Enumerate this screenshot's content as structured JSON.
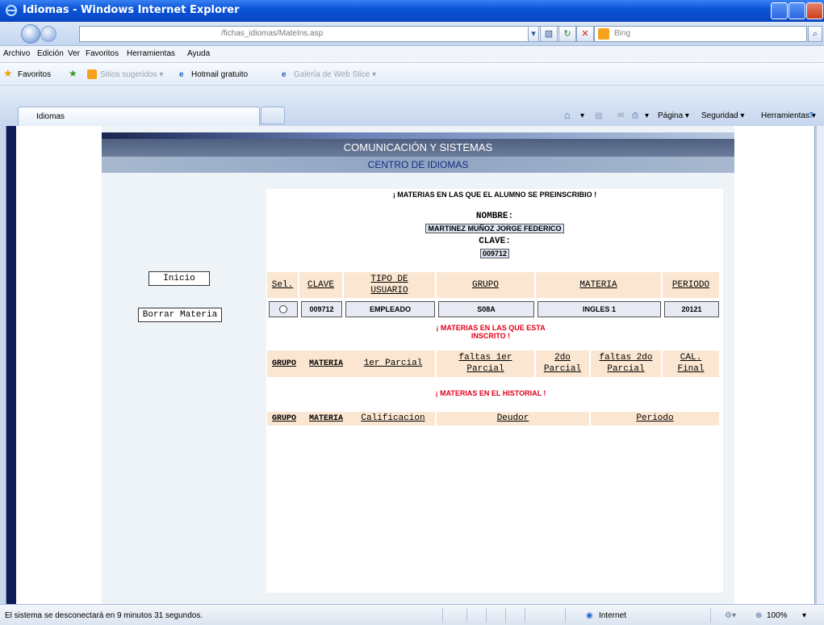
{
  "window": {
    "title": "Idiomas - Windows Internet Explorer"
  },
  "address": {
    "url": "/fichas_idiomas/MateIns.asp",
    "search_placeholder": "Bing"
  },
  "menu": {
    "items": [
      "Archivo",
      "Edición",
      "Ver",
      "Favoritos",
      "Herramientas",
      "Ayuda"
    ]
  },
  "favorites": {
    "label": "Favoritos",
    "sitios": "Sitios sugeridos ▾",
    "hotmail": "Hotmail gratuito",
    "galeria": "Galería de Web Slice ▾"
  },
  "tab": {
    "title": "Idiomas"
  },
  "commands": {
    "pagina": "Página ▾",
    "seguridad": "Seguridad ▾",
    "herramientas": "Herramientas ▾"
  },
  "page": {
    "banner1": "COMUNICACIÓN Y SISTEMAS",
    "banner2": "CENTRO DE IDIOMAS",
    "heading": "¡ MATERIAS EN LAS QUE EL ALUMNO SE PREINSCRIBIO !",
    "nombre_label": "NOMBRE:",
    "nombre_value": "MARTINEZ MUÑOZ JORGE FEDERICO",
    "clave_label": "CLAVE:",
    "clave_value": "009712",
    "btn_inicio": "Inicio",
    "btn_borrar": "Borrar Materia",
    "table1": {
      "headers": [
        "Sel.",
        "CLAVE",
        "TIPO DE USUARIO",
        "GRUPO",
        "MATERIA",
        "PERIODO"
      ],
      "row": [
        "009712",
        "EMPLEADO",
        "S08A",
        "INGLES 1",
        "20121"
      ]
    },
    "inscrito_heading": "¡ MATERIAS EN LAS QUE ESTA INSCRITO !",
    "table2": {
      "headers": [
        "GRUPO",
        "MATERIA",
        "1er Parcial",
        "faltas 1er Parcial",
        "2do Parcial",
        "faltas 2do Parcial",
        "CAL. Final"
      ]
    },
    "historial_heading": "¡ MATERIAS EN EL HISTORIAL !",
    "table3": {
      "headers": [
        "GRUPO",
        "MATERIA",
        "Calificacion",
        "Deudor",
        "Periodo"
      ]
    }
  },
  "status": {
    "message": "El sistema se desconectará en 9 minutos 31 segundos.",
    "zone": "Internet",
    "zoom": "100%"
  }
}
